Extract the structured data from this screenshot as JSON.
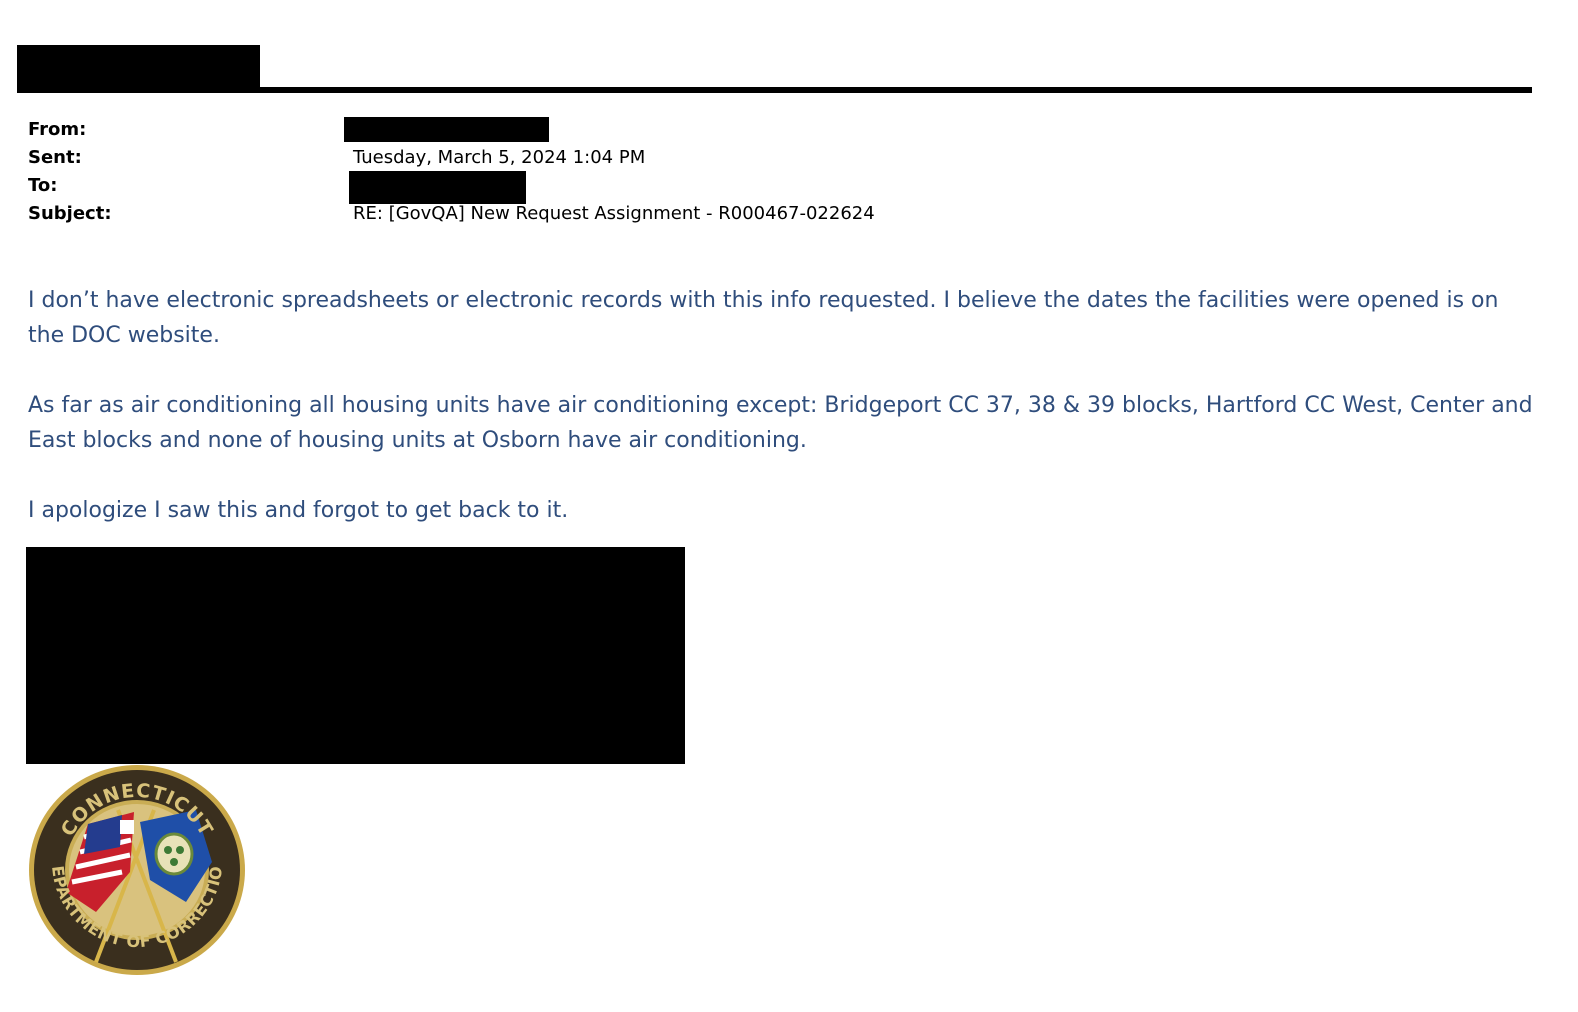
{
  "header": {
    "from_label": "From:",
    "sent_label": "Sent:",
    "sent_value": "Tuesday, March 5, 2024 1:04 PM",
    "to_label": "To:",
    "subject_label": "Subject:",
    "subject_value": "RE: [GovQA] New Request Assignment - R000467-022624"
  },
  "body": {
    "paragraphs": [
      "I don’t have electronic spreadsheets or electronic records with this info requested. I believe the dates the facilities were opened is on the DOC website.",
      "As far as air conditioning all housing units have air conditioning except: Bridgeport CC 37, 38 & 39 blocks,  Hartford CC  West, Center and East blocks  and none of housing units at Osborn have air conditioning.",
      "I apologize I saw this and forgot to get back to it."
    ]
  },
  "seal": {
    "top_text": "CONNECTICUT",
    "bottom_text": "DEPARTMENT OF CORRECTION"
  },
  "colors": {
    "body_text": "#2f4d7c",
    "redaction": "#000000"
  }
}
